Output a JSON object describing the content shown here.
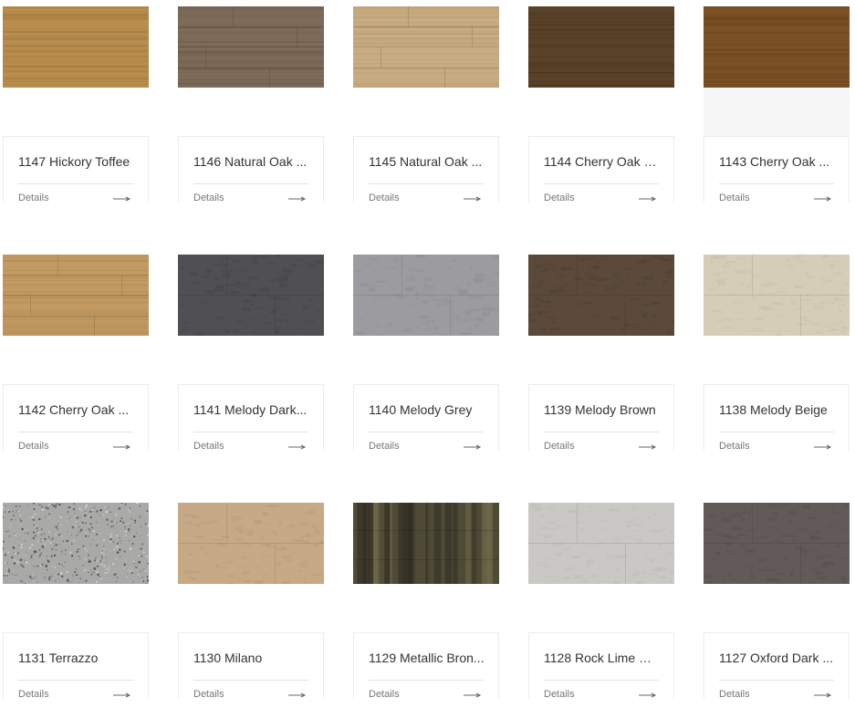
{
  "products": [
    {
      "name": "1147 Hickory Toffee",
      "details_label": "Details",
      "texture": "wood",
      "colors": [
        "#b98d4d",
        "#a07a40"
      ]
    },
    {
      "name": "1146 Natural Oak ...",
      "details_label": "Details",
      "texture": "wood-plank",
      "colors": [
        "#7e6c5a",
        "#6a5a49"
      ]
    },
    {
      "name": "1145 Natural Oak ...",
      "details_label": "Details",
      "texture": "wood-plank",
      "colors": [
        "#c9ad82",
        "#b49a72"
      ]
    },
    {
      "name": "1144 Cherry Oak B...",
      "details_label": "Details",
      "texture": "wood",
      "colors": [
        "#5a4328",
        "#4a3620"
      ]
    },
    {
      "name": "1143 Cherry Oak ...",
      "details_label": "Details",
      "texture": "wood",
      "colors": [
        "#7b5125",
        "#6a441e"
      ]
    },
    {
      "name": "1142 Cherry Oak ...",
      "details_label": "Details",
      "texture": "wood-plank",
      "colors": [
        "#c29a62",
        "#b08a55"
      ]
    },
    {
      "name": "1141 Melody Dark...",
      "details_label": "Details",
      "texture": "tile",
      "colors": [
        "#505052",
        "#454547"
      ]
    },
    {
      "name": "1140 Melody Grey",
      "details_label": "Details",
      "texture": "tile",
      "colors": [
        "#9c9c9e",
        "#8f8f91"
      ]
    },
    {
      "name": "1139 Melody Brown",
      "details_label": "Details",
      "texture": "tile",
      "colors": [
        "#5b4a3a",
        "#4f4032"
      ]
    },
    {
      "name": "1138 Melody Beige",
      "details_label": "Details",
      "texture": "tile",
      "colors": [
        "#d6cdb8",
        "#c8bea8"
      ]
    },
    {
      "name": "1131 Terrazzo",
      "details_label": "Details",
      "texture": "speckle",
      "colors": [
        "#a9a9a7",
        "#4a4a4a"
      ]
    },
    {
      "name": "1130 Milano",
      "details_label": "Details",
      "texture": "tile",
      "colors": [
        "#c8a985",
        "#b89a78"
      ]
    },
    {
      "name": "1129 Metallic Bron...",
      "details_label": "Details",
      "texture": "metallic",
      "colors": [
        "#4e4a36",
        "#7a7250"
      ]
    },
    {
      "name": "1128 Rock Lime W...",
      "details_label": "Details",
      "texture": "tile",
      "colors": [
        "#c9c8c4",
        "#bdbcb8"
      ]
    },
    {
      "name": "1127 Oxford Dark ...",
      "details_label": "Details",
      "texture": "tile",
      "colors": [
        "#625a58",
        "#554e4c"
      ]
    }
  ]
}
